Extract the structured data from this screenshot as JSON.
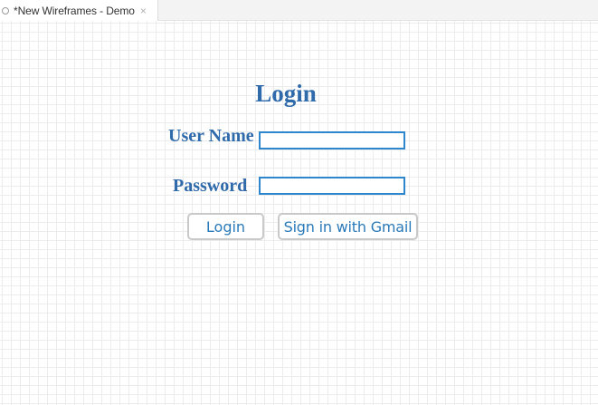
{
  "tab": {
    "title": "*New Wireframes - Demo",
    "close_glyph": "×",
    "dirty_icon": "circle-outline-icon"
  },
  "form": {
    "title": "Login",
    "username_label": "User Name",
    "username_value": "",
    "password_label": "Password",
    "password_value": "",
    "login_button": "Login",
    "gmail_button": "Sign in with Gmail"
  },
  "colors": {
    "label_blue": "#2f6aaa",
    "input_border": "#2e86cc",
    "button_text": "#2a7ab9",
    "button_border": "#c9c9c9",
    "grid_line": "#ececec"
  }
}
